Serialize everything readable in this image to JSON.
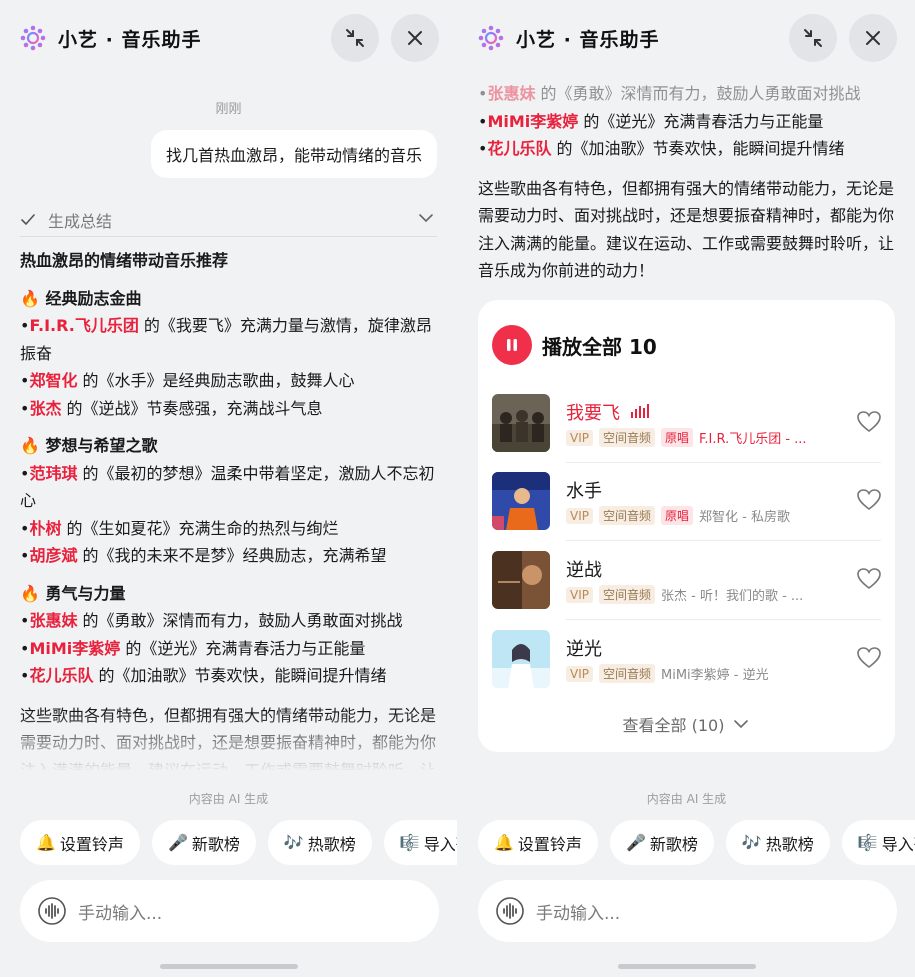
{
  "app": {
    "title": "小艺 · 音乐助手"
  },
  "chat": {
    "time": "刚刚",
    "user_message": "找几首热血激昂，能带动情绪的音乐",
    "summary_label": "生成总结"
  },
  "answer": {
    "heading": "热血激昂的情绪带动音乐推荐",
    "sections": [
      {
        "emoji": "🔥",
        "title": "经典励志金曲",
        "items": [
          {
            "bullet": "•",
            "artist": "F.I.R.飞儿乐团",
            "text": " 的《我要飞》充满力量与激情，旋律激昂振奋"
          },
          {
            "bullet": "•",
            "artist": "郑智化",
            "text": " 的《水手》是经典励志歌曲，鼓舞人心"
          },
          {
            "bullet": "•",
            "artist": "张杰",
            "text": " 的《逆战》节奏感强，充满战斗气息"
          }
        ]
      },
      {
        "emoji": "🔥",
        "title": "梦想与希望之歌",
        "items": [
          {
            "bullet": "•",
            "artist": "范玮琪",
            "text": " 的《最初的梦想》温柔中带着坚定，激励人不忘初心"
          },
          {
            "bullet": "•",
            "artist": "朴树",
            "text": " 的《生如夏花》充满生命的热烈与绚烂"
          },
          {
            "bullet": "•",
            "artist": "胡彦斌",
            "text": " 的《我的未来不是梦》经典励志，充满希望"
          }
        ]
      },
      {
        "emoji": "🔥",
        "title": "勇气与力量",
        "items": [
          {
            "bullet": "•",
            "artist": "张惠妹",
            "text": " 的《勇敢》深情而有力，鼓励人勇敢面对挑战"
          },
          {
            "bullet": "•",
            "artist": "MiMi李紫婷",
            "text": " 的《逆光》充满青春活力与正能量"
          },
          {
            "bullet": "•",
            "artist": "花儿乐队",
            "text": " 的《加油歌》节奏欢快，能瞬间提升情绪"
          }
        ]
      }
    ],
    "closing": "这些歌曲各有特色，但都拥有强大的情绪带动能力，无论是需要动力时、面对挑战时，还是想要振奋精神时，都能为你注入满满的能量。建议在运动、工作或需要鼓舞时聆听，让音乐成为你前进的动力！"
  },
  "music_card": {
    "play_all_label": "播放全部 10",
    "view_all_label": "查看全部 (10)",
    "songs": [
      {
        "name": "我要飞",
        "playing": true,
        "tags": [
          "VIP",
          "空间音频",
          "原唱"
        ],
        "subtitle": "F.I.R.飞儿乐团 - ..."
      },
      {
        "name": "水手",
        "playing": false,
        "tags": [
          "VIP",
          "空间音频",
          "原唱"
        ],
        "subtitle": "郑智化 - 私房歌"
      },
      {
        "name": "逆战",
        "playing": false,
        "tags": [
          "VIP",
          "空间音频"
        ],
        "subtitle": "张杰 - 听！我们的歌 - ..."
      },
      {
        "name": "逆光",
        "playing": false,
        "tags": [
          "VIP",
          "空间音频"
        ],
        "subtitle": "MiMi李紫婷 - 逆光"
      }
    ]
  },
  "footer": {
    "ai_note": "内容由 AI 生成",
    "chips": [
      {
        "icon": "🔔",
        "label": "设置铃声"
      },
      {
        "icon": "🎤",
        "label": "新歌榜"
      },
      {
        "icon": "🎶",
        "label": "热歌榜"
      },
      {
        "icon": "🎼",
        "label": "导入歌"
      }
    ],
    "input_placeholder": "手动输入..."
  },
  "colors": {
    "accent_red": "#e8223c",
    "play_red": "#f0304b",
    "background": "#f1f2f4"
  }
}
